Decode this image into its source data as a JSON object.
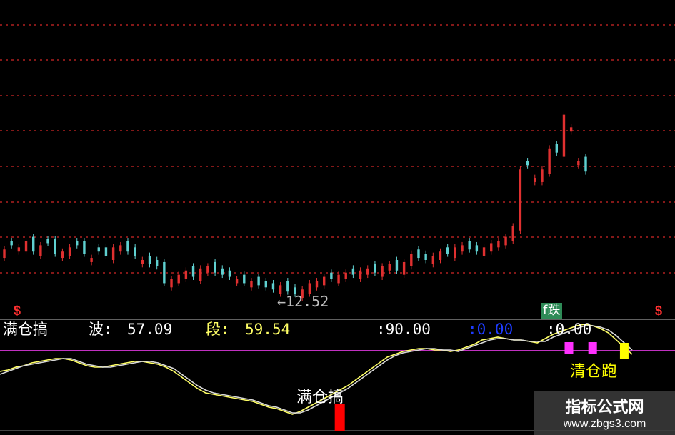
{
  "colors": {
    "background": "#000000",
    "up": "#e03030",
    "down": "#5fd0d0",
    "grid": "#b02020",
    "signal_line": "#ffff66",
    "signal_line2": "#d8d8d8",
    "band": "#c030c0",
    "buy_bar": "#ff0000",
    "sell_marker": "#ffff00",
    "hold_marker": "#ff30ff"
  },
  "top_price_label": "←12.52",
  "badge_text": "f跌",
  "dollar_left": "$",
  "dollar_right": "$",
  "indicator": {
    "name": "满仓搞",
    "wave_label": "波:",
    "wave_value": "57.09",
    "segment_label": "段:",
    "segment_value": "59.54",
    "level1": ":90.00",
    "level2": ":0.00",
    "level3": ":0.00"
  },
  "annotations": {
    "buy": "满仓搞",
    "sell": "清仓跑"
  },
  "watermark": {
    "title": "指标公式网",
    "url": "www.zbgs3.com"
  },
  "chart_data": [
    {
      "type": "candlestick",
      "title": "",
      "gridlines": "dashed horizontal",
      "price_low_marker": 12.52,
      "candles_close_series": [
        54,
        56,
        55,
        58,
        53,
        56,
        57,
        52,
        53,
        55,
        56,
        52,
        50,
        53,
        51,
        55,
        56,
        53,
        51,
        49,
        47,
        46,
        38,
        40,
        42,
        44,
        41,
        45,
        46,
        43,
        42,
        41,
        40,
        38,
        39,
        37,
        36,
        35,
        37,
        34,
        33,
        35,
        38,
        39,
        41,
        40,
        42,
        43,
        42,
        44,
        45,
        43,
        46,
        47,
        44,
        48,
        52,
        50,
        49,
        51,
        53,
        52,
        55,
        56,
        54,
        53,
        55,
        57,
        58,
        60,
        65,
        92,
        94,
        88,
        92,
        102,
        100,
        118,
        112,
        96,
        91
      ],
      "candles_direction": [
        "up",
        "down",
        "up",
        "up",
        "down",
        "up",
        "down",
        "down",
        "up",
        "up",
        "down",
        "down",
        "up",
        "down",
        "down",
        "up",
        "up",
        "down",
        "down",
        "up",
        "down",
        "down",
        "down",
        "up",
        "up",
        "up",
        "down",
        "up",
        "up",
        "down",
        "down",
        "down",
        "up",
        "down",
        "up",
        "down",
        "down",
        "down",
        "up",
        "down",
        "down",
        "up",
        "up",
        "up",
        "up",
        "down",
        "up",
        "up",
        "down",
        "up",
        "up",
        "down",
        "up",
        "up",
        "down",
        "up",
        "up",
        "down",
        "down",
        "up",
        "up",
        "down",
        "up",
        "up",
        "down",
        "down",
        "up",
        "up",
        "up",
        "up",
        "up",
        "up",
        "down",
        "up",
        "up",
        "up",
        "down",
        "up",
        "up",
        "up",
        "down"
      ]
    },
    {
      "type": "line",
      "title": "满仓搞",
      "series": [
        {
          "name": "波",
          "values": [
            40,
            41,
            43,
            44,
            46,
            47,
            48,
            49,
            49,
            48,
            46,
            44,
            43,
            43,
            44,
            45,
            46,
            47,
            47,
            46,
            45,
            43,
            40,
            36,
            32,
            28,
            25,
            24,
            23,
            22,
            21,
            20,
            19,
            17,
            15,
            14,
            12,
            10,
            12,
            15,
            18,
            21,
            24,
            27,
            30,
            34,
            38,
            42,
            46,
            50,
            52,
            54,
            55,
            56,
            56,
            55,
            55,
            54,
            55,
            57,
            59,
            62,
            63,
            64,
            63,
            62,
            62,
            61,
            60,
            63,
            66,
            68,
            70,
            72,
            73,
            72,
            70,
            67,
            62,
            57,
            52
          ]
        },
        {
          "name": "段",
          "values": [
            38,
            40,
            42,
            44,
            45,
            46,
            47,
            48,
            49,
            49,
            47,
            45,
            44,
            43,
            43,
            44,
            45,
            46,
            47,
            47,
            46,
            44,
            42,
            38,
            34,
            30,
            27,
            25,
            24,
            23,
            22,
            21,
            20,
            18,
            16,
            15,
            13,
            11,
            11,
            13,
            16,
            19,
            22,
            25,
            28,
            32,
            36,
            40,
            44,
            48,
            51,
            53,
            54,
            55,
            56,
            56,
            55,
            55,
            54,
            56,
            58,
            60,
            62,
            63,
            63,
            62,
            62,
            61,
            61,
            61,
            64,
            66,
            68,
            70,
            72,
            72,
            71,
            69,
            65,
            60,
            55
          ]
        }
      ],
      "levels": [
        90.0,
        0.0,
        0.0
      ],
      "buy_signal_index": 43,
      "sell_signal_index": 79,
      "hold_signal_indices": [
        72,
        75
      ]
    }
  ]
}
